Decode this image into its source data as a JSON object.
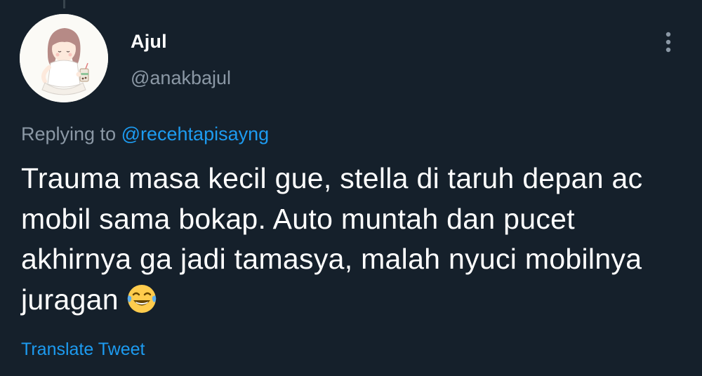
{
  "tweet": {
    "author": {
      "display_name": "Ajul",
      "handle": "@anakbajul",
      "avatar_icon": "avatar-illustration-girl-with-drink"
    },
    "replying_prefix": "Replying to",
    "replying_to": "@recehtapisayng",
    "text": "Trauma masa kecil gue, stella di taruh depan ac mobil sama bokap. Auto muntah dan pucet akhirnya ga jadi tamasya, malah nyuci mobilnya juragan",
    "emoji": "tears-of-joy-emoji",
    "translate_label": "Translate Tweet",
    "more_icon": "more-vertical-icon"
  },
  "colors": {
    "background": "#15202b",
    "text_primary": "#ffffff",
    "text_secondary": "#8b98a5",
    "accent": "#1d9bf0"
  }
}
